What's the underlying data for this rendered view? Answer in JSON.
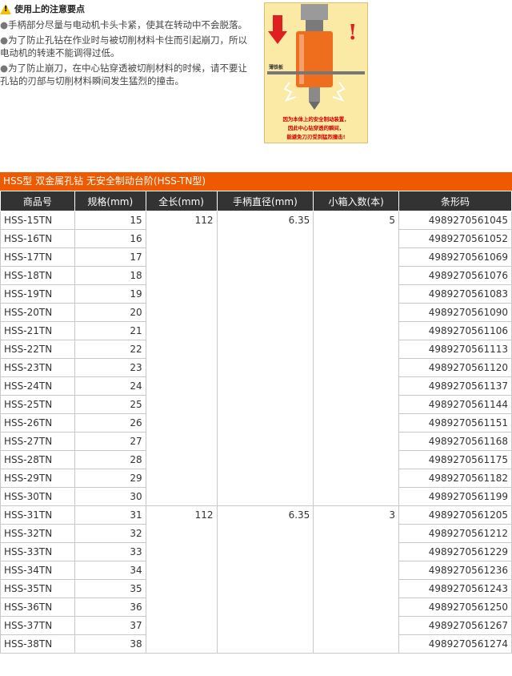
{
  "notes": {
    "heading": "使用上的注意要点",
    "bullet": "●",
    "items": [
      "手柄部分尽量与电动机卡头卡紧，使其在转动中不会脱落。",
      "为了防止孔钻在作业时与被切削材料卡住而引起崩刀，所以电动机的转速不能调得过低。",
      "为了防止崩刀，在中心钻穿透被切削材料的时候，请不要让孔钻的刃部与切削材料瞬间发生猛烈的撞击。"
    ]
  },
  "illustration": {
    "label": "薄铁板",
    "caption": [
      "因为本体上的安全制动装置，",
      "因此中心钻穿透的瞬间，",
      "能避免刀刃受到猛烈撞击!"
    ],
    "colors": {
      "background": "#fbe9a6",
      "body": "#ef6e1d",
      "arrow": "#e02020",
      "text": "#d00000"
    }
  },
  "table": {
    "title": "HSS型 双金属孔钻 无安全制动台阶(HSS-TN型)",
    "headers": [
      "商品号",
      "规格(mm)",
      "全长(mm)",
      "手柄直径(mm)",
      "小箱入数(本)",
      "条形码"
    ],
    "groups": [
      {
        "length": "112",
        "shank": "6.35",
        "box": "5",
        "rows": [
          [
            "HSS-15TN",
            "15",
            "4989270561045"
          ],
          [
            "HSS-16TN",
            "16",
            "4989270561052"
          ],
          [
            "HSS-17TN",
            "17",
            "4989270561069"
          ],
          [
            "HSS-18TN",
            "18",
            "4989270561076"
          ],
          [
            "HSS-19TN",
            "19",
            "4989270561083"
          ],
          [
            "HSS-20TN",
            "20",
            "4989270561090"
          ],
          [
            "HSS-21TN",
            "21",
            "4989270561106"
          ],
          [
            "HSS-22TN",
            "22",
            "4989270561113"
          ],
          [
            "HSS-23TN",
            "23",
            "4989270561120"
          ],
          [
            "HSS-24TN",
            "24",
            "4989270561137"
          ],
          [
            "HSS-25TN",
            "25",
            "4989270561144"
          ],
          [
            "HSS-26TN",
            "26",
            "4989270561151"
          ],
          [
            "HSS-27TN",
            "27",
            "4989270561168"
          ],
          [
            "HSS-28TN",
            "28",
            "4989270561175"
          ],
          [
            "HSS-29TN",
            "29",
            "4989270561182"
          ],
          [
            "HSS-30TN",
            "30",
            "4989270561199"
          ]
        ]
      },
      {
        "length": "112",
        "shank": "6.35",
        "box": "3",
        "rows": [
          [
            "HSS-31TN",
            "31",
            "4989270561205"
          ],
          [
            "HSS-32TN",
            "32",
            "4989270561212"
          ],
          [
            "HSS-33TN",
            "33",
            "4989270561229"
          ],
          [
            "HSS-34TN",
            "34",
            "4989270561236"
          ],
          [
            "HSS-35TN",
            "35",
            "4989270561243"
          ],
          [
            "HSS-36TN",
            "36",
            "4989270561250"
          ],
          [
            "HSS-37TN",
            "37",
            "4989270561267"
          ],
          [
            "HSS-38TN",
            "38",
            "4989270561274"
          ]
        ]
      }
    ]
  }
}
